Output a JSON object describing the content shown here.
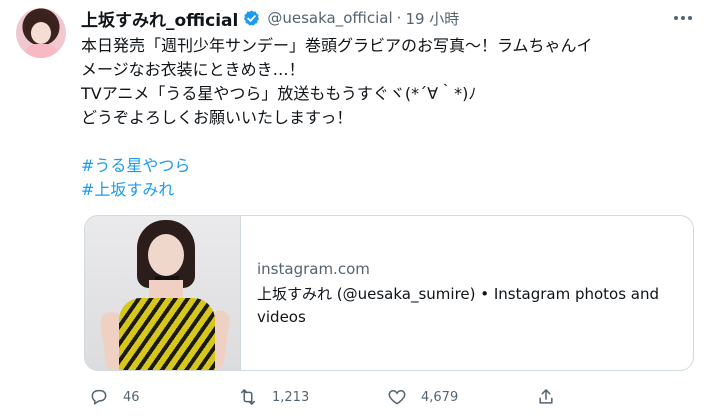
{
  "tweet": {
    "author_name": "上坂すみれ_official",
    "handle": "@uesaka_official",
    "separator": "·",
    "time": "19 小時",
    "text_lines": [
      "本日発売「週刊少年サンデー」巻頭グラビアのお写真〜！ラムちゃんイ",
      "メージなお衣装にときめき…！",
      "TVアニメ「うる星やつら」放送ももうすぐヾ(*´∀｀*)ﾉ",
      "どうぞよろしくお願いいたしますっ！"
    ],
    "hashtags": [
      "#うる星やつら",
      "#上坂すみれ"
    ]
  },
  "card": {
    "domain": "instagram.com",
    "title": "上坂すみれ (@uesaka_sumire) • Instagram photos and videos"
  },
  "actions": {
    "reply_count": "46",
    "retweet_count": "1,213",
    "like_count": "4,679"
  },
  "icons": {
    "verified": "verified-badge-icon",
    "more": "more-dots-icon",
    "reply": "reply-icon",
    "retweet": "retweet-icon",
    "like": "heart-icon",
    "share": "share-icon"
  },
  "colors": {
    "text": "#0f1419",
    "secondary": "#536471",
    "link": "#1d9bf0",
    "border": "#cfd9de"
  }
}
